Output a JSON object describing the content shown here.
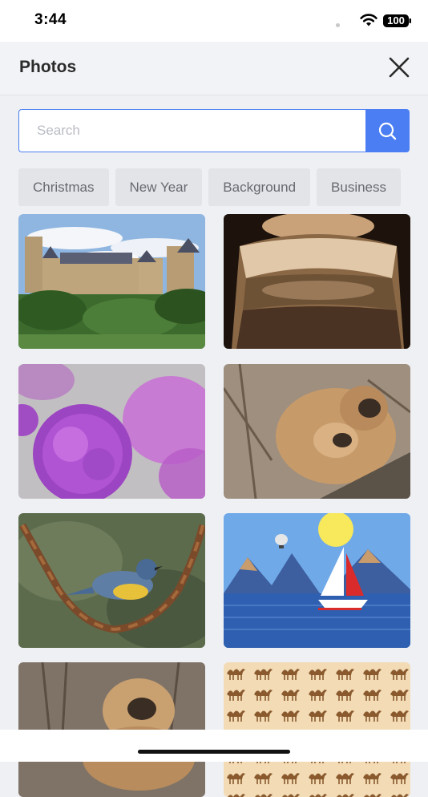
{
  "status": {
    "time": "3:44",
    "battery": "100"
  },
  "header": {
    "title": "Photos"
  },
  "search": {
    "placeholder": "Search",
    "value": ""
  },
  "categories": [
    "Christmas",
    "New Year",
    "Background",
    "Business"
  ],
  "photos": [
    {
      "subject": "castle"
    },
    {
      "subject": "jar"
    },
    {
      "subject": "purple-flowers"
    },
    {
      "subject": "monkeys"
    },
    {
      "subject": "bird-on-chain"
    },
    {
      "subject": "sailboat"
    },
    {
      "subject": "monkey"
    },
    {
      "subject": "camel-pattern"
    }
  ],
  "colors": {
    "accent": "#4b7ef2",
    "header_bg": "#f2f3f7",
    "page_bg": "#eff0f4",
    "chip_bg": "#e3e4e8"
  }
}
